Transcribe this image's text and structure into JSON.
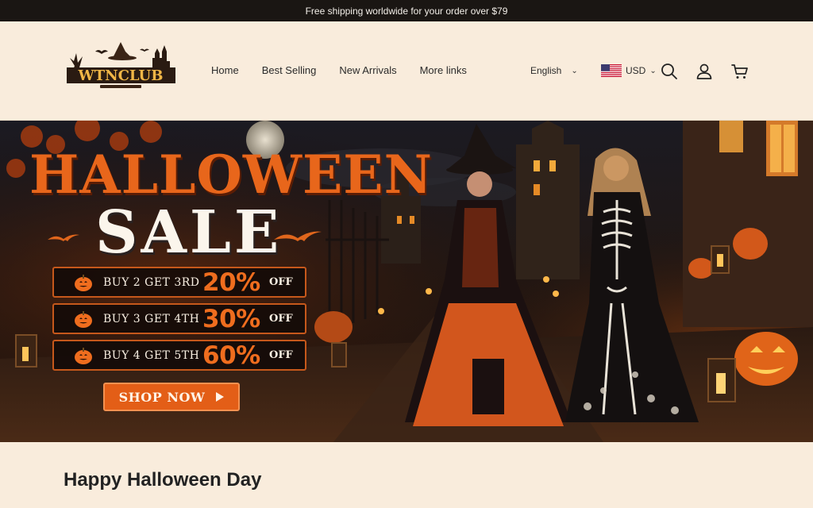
{
  "announcement": {
    "text": "Free shipping worldwide for your order over $79"
  },
  "header": {
    "logo_text": "WTNCLUB",
    "nav": [
      {
        "label": "Home"
      },
      {
        "label": "Best Selling"
      },
      {
        "label": "New Arrivals"
      },
      {
        "label": "More links"
      }
    ],
    "language": "English",
    "currency": "USD",
    "icons": [
      "search-icon",
      "account-icon",
      "cart-icon"
    ]
  },
  "hero": {
    "title_line1": "HALLOWEEN",
    "title_line2": "SALE",
    "promos": [
      {
        "buy": "BUY 2 GET 3RD",
        "percent": "20%",
        "off": "OFF"
      },
      {
        "buy": "BUY 3 GET 4TH",
        "percent": "30%",
        "off": "OFF"
      },
      {
        "buy": "BUY 4 GET 5TH",
        "percent": "60%",
        "off": "OFF"
      }
    ],
    "cta": "SHOP NOW"
  },
  "section": {
    "heading": "Happy Halloween Day"
  },
  "colors": {
    "accent": "#e35e17",
    "background": "#f9ecdc",
    "announce_bg": "#1a1613"
  }
}
